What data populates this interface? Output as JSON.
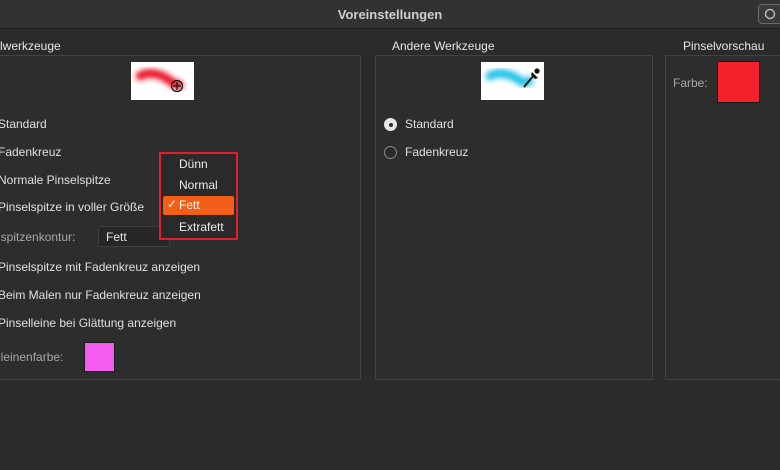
{
  "window": {
    "title": "Voreinstellungen"
  },
  "colors": {
    "brush_preview": "#e8192a",
    "guide_line_color": "#f55cf0",
    "other_preview": "#27c3e8",
    "preview_color": "#f2202a",
    "dropdown_highlight": "#f25f18",
    "annotation_border": "#e0202a"
  },
  "painting_tools": {
    "title": "lwerkzeuge",
    "options": [
      {
        "label": "Standard"
      },
      {
        "label": "Fadenkreuz"
      },
      {
        "label": "Normale Pinselspitze"
      },
      {
        "label": "Pinselspitze in voller Größe"
      }
    ],
    "outline_label": "lspitzenkontur:",
    "outline_value": "Fett",
    "checkboxes": [
      {
        "label": "Pinselspitze mit Fadenkreuz anzeigen"
      },
      {
        "label": "Beim Malen nur Fadenkreuz anzeigen"
      },
      {
        "label": "Pinselleine bei Glättung anzeigen"
      }
    ],
    "line_color_label": "lleinenfarbe:"
  },
  "outline_dropdown": {
    "options": [
      "Dünn",
      "Normal",
      "Fett",
      "Extrafett"
    ],
    "selected": "Fett",
    "check_glyph": "✓"
  },
  "other_tools": {
    "title": "Andere Werkzeuge",
    "options": [
      {
        "label": "Standard",
        "selected": true
      },
      {
        "label": "Fadenkreuz",
        "selected": false
      }
    ]
  },
  "brush_preview": {
    "title": "Pinselvorschau",
    "color_label": "Farbe:"
  }
}
